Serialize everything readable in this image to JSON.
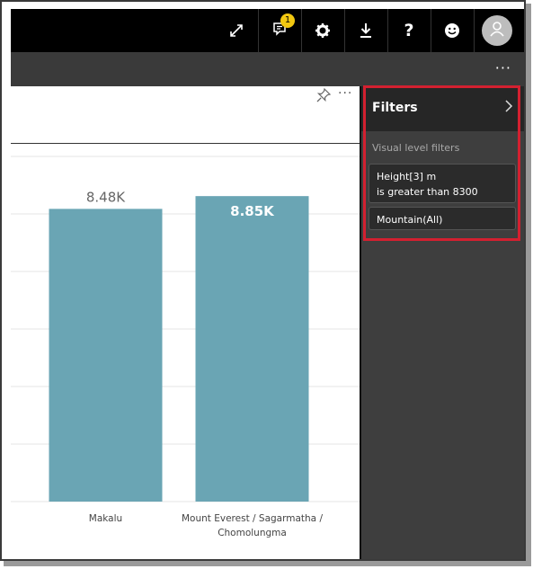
{
  "topbar": {
    "icons": [
      "expand-icon",
      "comments-icon",
      "gear-icon",
      "download-icon",
      "help-icon",
      "smiley-icon",
      "avatar"
    ],
    "notification_count": "1",
    "help_label": "?"
  },
  "subbar": {
    "more_label": "···"
  },
  "visual": {
    "more_label": "···"
  },
  "filters": {
    "title": "Filters",
    "section": "Visual level filters",
    "cards": [
      {
        "line1": "Height[3] m",
        "line2": "is greater than 8300"
      },
      {
        "line1": "Mountain(All)"
      }
    ]
  },
  "colors": {
    "bar": "#6aa5b4",
    "highlight": "#d32030",
    "topbar": "#000000",
    "filter_pane": "#3e3e3e"
  },
  "chart_data": {
    "type": "bar",
    "categories": [
      "Makalu",
      "Mount Everest / Sagarmatha / Chomolungma"
    ],
    "category_lines": [
      [
        "Makalu"
      ],
      [
        "Mount Everest / Sagarmatha /",
        "Chomolungma"
      ]
    ],
    "values": [
      8.48,
      8.85
    ],
    "data_labels": [
      "8.48K",
      "8.85K"
    ],
    "ylim": [
      0,
      10
    ],
    "grid": true
  }
}
